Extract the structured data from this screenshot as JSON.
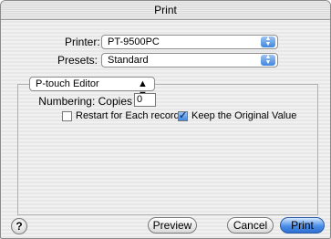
{
  "window": {
    "title": "Print"
  },
  "printer": {
    "label": "Printer:",
    "value": "PT-9500PC"
  },
  "presets": {
    "label": "Presets:",
    "value": "Standard"
  },
  "panel": {
    "value": "P-touch Editor"
  },
  "numbering": {
    "label": "Numbering: Copies",
    "value": "0"
  },
  "restart": {
    "label": "Restart for Each record",
    "checked": false
  },
  "keep": {
    "label": "Keep the Original Value",
    "checked": true
  },
  "buttons": {
    "help": "?",
    "preview": "Preview",
    "cancel": "Cancel",
    "print": "Print"
  },
  "icons": {
    "popup": "up-down-arrows-icon",
    "check": "checkmark-icon",
    "help": "question-icon"
  }
}
